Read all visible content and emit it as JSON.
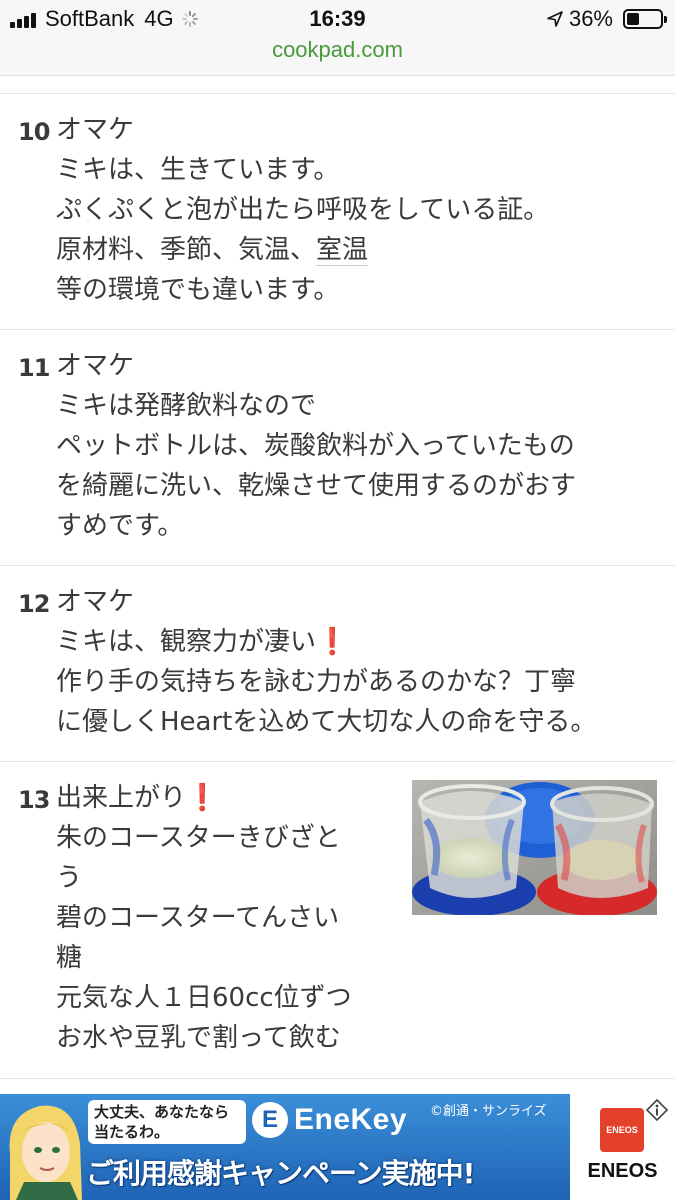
{
  "status_bar": {
    "carrier": "SoftBank",
    "network": "4G",
    "time": "16:39",
    "battery": "36%",
    "battery_level": 0.36
  },
  "url_bar": {
    "domain": "cookpad.com"
  },
  "steps": [
    {
      "number": "10",
      "lines": [
        [
          {
            "text": "オマケ"
          }
        ],
        [
          {
            "text": "ミキは、生きています。"
          }
        ],
        [
          {
            "text": "ぷくぷくと泡が出たら呼吸をしている証。"
          }
        ],
        [
          {
            "text": "原材料、季節、気温、"
          },
          {
            "text": "室温",
            "underline": true
          }
        ],
        [
          {
            "text": "等の環境でも違います。"
          }
        ]
      ]
    },
    {
      "number": "11",
      "lines": [
        [
          {
            "text": "オマケ"
          }
        ],
        [
          {
            "text": "ミキは発酵飲料なので"
          }
        ],
        [
          {
            "text": "ペットボトルは、炭酸飲料が入っていたもの"
          }
        ],
        [
          {
            "text": "を綺麗に洗い、乾燥させて使用するのがおす"
          }
        ],
        [
          {
            "text": "すめです。"
          }
        ]
      ]
    },
    {
      "number": "12",
      "lines": [
        [
          {
            "text": "オマケ"
          }
        ],
        [
          {
            "text": "ミキは、観察力が凄い"
          },
          {
            "text": "❗",
            "excl": true
          }
        ],
        [
          {
            "text": "作り手の気持ちを詠む力があるのかな？丁寧"
          }
        ],
        [
          {
            "text": "に優しくHeartを込めて大切な人の命を守る。"
          }
        ]
      ]
    },
    {
      "number": "13",
      "photo_alt": "step-13-photo",
      "lines": [
        [
          {
            "text": "出来上がり"
          },
          {
            "text": "❗",
            "excl": true
          }
        ],
        [
          {
            "text": "朱のコースターきびざと"
          }
        ],
        [
          {
            "text": "う"
          }
        ],
        [
          {
            "text": "碧のコースターてんさい"
          }
        ],
        [
          {
            "text": "糖"
          }
        ],
        [
          {
            "text": "元気な人１日60cc位ずつ"
          }
        ],
        [
          {
            "text": "お水や豆乳で割って飲む"
          }
        ]
      ]
    }
  ],
  "ad": {
    "bubble_lines": [
      "大丈夫、あなたなら",
      "当たるわ。"
    ],
    "brand": "EneKey",
    "logo_letter": "E",
    "copyright": "©創通・サンライズ",
    "headline": "ご利用感謝キャンペーン実施中!",
    "sponsor": "ENEOS",
    "colors": {
      "banner": "#2a78cc",
      "sponsor_red": "#e4412b"
    }
  },
  "colors": {
    "url_green": "#4a9a3c",
    "divider": "#ece4dc",
    "exclamation": "#e0242a"
  }
}
